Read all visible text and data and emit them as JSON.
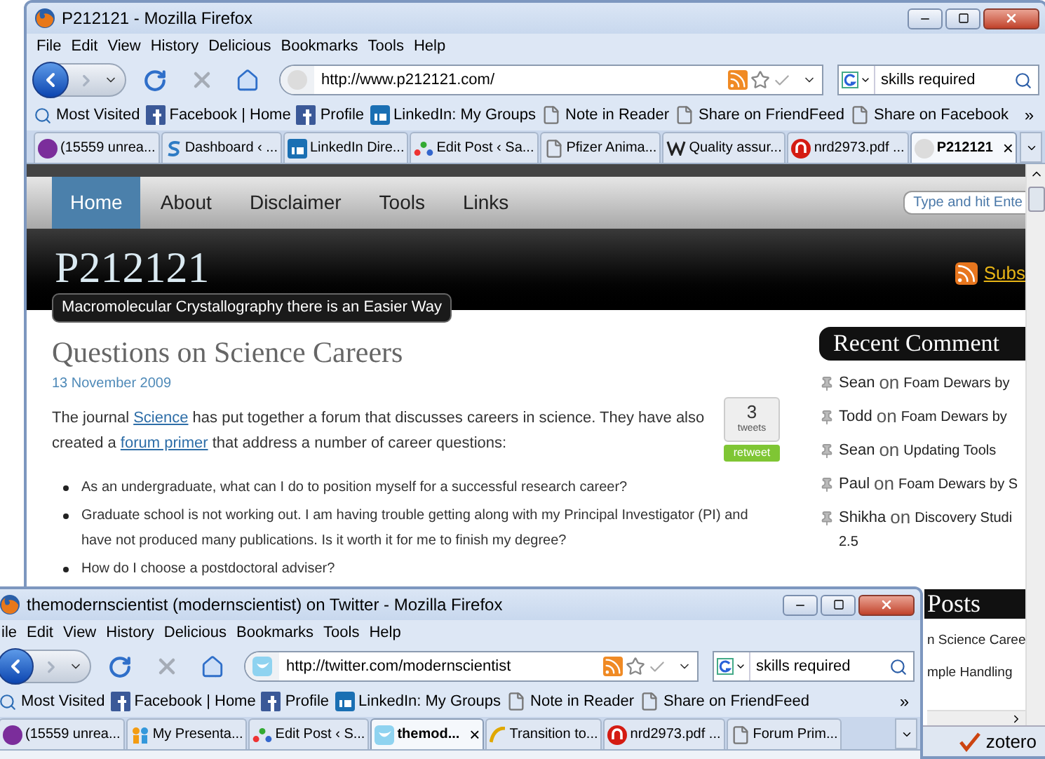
{
  "back_window": {
    "title": "P212121 - Mozilla Firefox",
    "menu": [
      "File",
      "Edit",
      "View",
      "History",
      "Delicious",
      "Bookmarks",
      "Tools",
      "Help"
    ],
    "url": "http://www.p212121.com/",
    "search": "skills required",
    "bookmarks": [
      {
        "label": "Most Visited",
        "kind": "magnifier"
      },
      {
        "label": "Facebook | Home",
        "kind": "square"
      },
      {
        "label": "Profile",
        "kind": "square"
      },
      {
        "label": "LinkedIn: My Groups",
        "kind": "linked"
      },
      {
        "label": "Note in Reader",
        "kind": "page"
      },
      {
        "label": "Share on FriendFeed",
        "kind": "page"
      },
      {
        "label": "Share on Facebook",
        "kind": "page"
      }
    ],
    "bookmarks_more": "»",
    "tabs": [
      {
        "label": "(15559 unrea...",
        "kind": "purple",
        "selected": false
      },
      {
        "label": "Dashboard ‹ ...",
        "kind": "swirl",
        "selected": false
      },
      {
        "label": "LinkedIn Dire...",
        "kind": "linked",
        "selected": false
      },
      {
        "label": "Edit Post ‹ Sa...",
        "kind": "dots",
        "selected": false
      },
      {
        "label": "Pfizer Anima...",
        "kind": "page",
        "selected": false
      },
      {
        "label": "Quality assur...",
        "kind": "tile",
        "selected": false
      },
      {
        "label": "nrd2973.pdf ...",
        "kind": "red",
        "selected": false
      },
      {
        "label": "P212121",
        "kind": "blank",
        "selected": true
      }
    ],
    "tab_close": "×",
    "page": {
      "nav": [
        {
          "label": "Home",
          "selected": true
        },
        {
          "label": "About",
          "selected": false
        },
        {
          "label": "Disclaimer",
          "selected": false
        },
        {
          "label": "Tools",
          "selected": false
        },
        {
          "label": "Links",
          "selected": false
        }
      ],
      "search_placeholder": "Type and hit Ente",
      "site_title": "P212121",
      "tagline": "Macromolecular Crystallography there is an Easier Way",
      "subscribe": "Subs",
      "post": {
        "title": "Questions on Science Careers",
        "date": "13 November 2009",
        "paragraph": [
          {
            "kind": "text",
            "text": "The journal "
          },
          {
            "kind": "link",
            "text": "Science"
          },
          {
            "kind": "text",
            "text": " has put together a forum that discusses careers in science. They have also created a "
          },
          {
            "kind": "link",
            "text": "forum primer"
          },
          {
            "kind": "text",
            "text": " that address a number of career questions:"
          }
        ],
        "tweets": {
          "count": "3",
          "label": "tweets",
          "button": "retweet"
        },
        "bullets": [
          "As an undergraduate, what can I do to position myself for a successful research career?",
          "Graduate school is not working out. I am having trouble getting along with my Principal Investigator (PI) and have not produced many publications. Is it worth it for me to finish my degree?",
          "How do I choose a postdoctoral adviser?"
        ]
      },
      "sidebar": {
        "title": "Recent Comment",
        "comments": [
          {
            "author": "Sean",
            "on": "on",
            "post": "Foam Dewars by"
          },
          {
            "author": "Todd",
            "on": "on",
            "post": "Foam Dewars by"
          },
          {
            "author": "Sean",
            "on": "on",
            "post": "Updating Tools"
          },
          {
            "author": "Paul",
            "on": "on",
            "post": "Foam Dewars by S"
          },
          {
            "author": "Shikha",
            "on": "on",
            "post": "Discovery Studi",
            "continued": "2.5"
          }
        ],
        "posts_title": "Posts",
        "posts": [
          "n Science Caree",
          "mple Handling"
        ]
      }
    },
    "status": "zotero"
  },
  "front_window": {
    "title": "themodernscientist (modernscientist) on Twitter - Mozilla Firefox",
    "menu": [
      "ile",
      "Edit",
      "View",
      "History",
      "Delicious",
      "Bookmarks",
      "Tools",
      "Help"
    ],
    "url": "http://twitter.com/modernscientist",
    "search": "skills required",
    "bookmarks": [
      {
        "label": "Most Visited",
        "kind": "magnifier"
      },
      {
        "label": "Facebook | Home",
        "kind": "square"
      },
      {
        "label": "Profile",
        "kind": "square"
      },
      {
        "label": "LinkedIn: My Groups",
        "kind": "linked"
      },
      {
        "label": "Note in Reader",
        "kind": "page"
      },
      {
        "label": "Share on FriendFeed",
        "kind": "page"
      }
    ],
    "bookmarks_more": "»",
    "tabs": [
      {
        "label": "(15559 unrea...",
        "kind": "purple",
        "selected": false
      },
      {
        "label": "My Presenta...",
        "kind": "people",
        "selected": false
      },
      {
        "label": "Edit Post ‹ S...",
        "kind": "dots",
        "selected": false
      },
      {
        "label": "themod...",
        "kind": "bubble",
        "selected": true
      },
      {
        "label": "Transition to...",
        "kind": "arc",
        "selected": false
      },
      {
        "label": "nrd2973.pdf ...",
        "kind": "red",
        "selected": false
      },
      {
        "label": "Forum Prim...",
        "kind": "page",
        "selected": false
      }
    ],
    "tab_close": "×"
  }
}
